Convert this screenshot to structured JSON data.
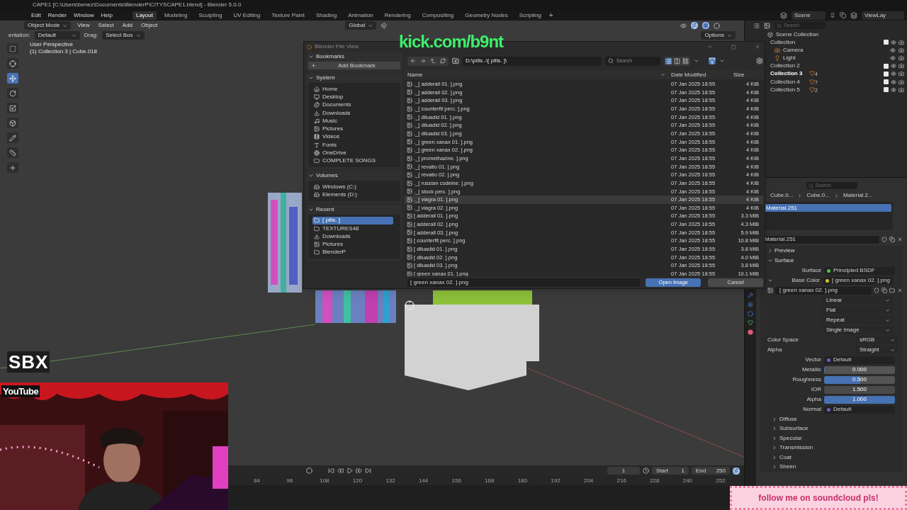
{
  "title_bar": {
    "title": "CAPE1 [C:\\Users\\benez\\Documents\\BlenderP\\CITYSCAPE1.blend] - Blender 5.0.0"
  },
  "menu": [
    "Edit",
    "Render",
    "Window",
    "Help"
  ],
  "workspaces": [
    {
      "label": "Layout",
      "selected": true
    },
    {
      "label": "Modeling",
      "selected": false
    },
    {
      "label": "Sculpting",
      "selected": false
    },
    {
      "label": "UV Editing",
      "selected": false
    },
    {
      "label": "Texture Paint",
      "selected": false
    },
    {
      "label": "Shading",
      "selected": false
    },
    {
      "label": "Animation",
      "selected": false
    },
    {
      "label": "Rendering",
      "selected": false
    },
    {
      "label": "Compositing",
      "selected": false
    },
    {
      "label": "Geometry Nodes",
      "selected": false
    },
    {
      "label": "Scripting",
      "selected": false
    }
  ],
  "add_workspace": "+",
  "scene": {
    "name": "Scene",
    "view_layer": "ViewLay"
  },
  "viewport_header": {
    "mode": "Object Mode",
    "menus": [
      "View",
      "Select",
      "Add",
      "Object"
    ],
    "orientation": "Global",
    "options": "Options"
  },
  "tool_settings": {
    "orientation_label": "entation:",
    "orientation": "Default",
    "drag_label": "Drag:",
    "drag": "Select Box"
  },
  "viewport_info": [
    "User Perspective",
    "(1) Collection 3 | Cube.018"
  ],
  "tools": [
    {
      "kind": "select",
      "selected": false
    },
    {
      "kind": "cursor",
      "selected": false
    },
    {
      "kind": "move",
      "selected": true
    },
    {
      "kind": "rotate",
      "selected": false
    },
    {
      "kind": "scale",
      "selected": false
    },
    {
      "kind": "transform",
      "selected": false
    },
    {
      "kind": "annotate",
      "selected": false
    },
    {
      "kind": "measure",
      "selected": false
    },
    {
      "kind": "add_cube",
      "selected": false
    }
  ],
  "outliner": {
    "search_placeholder": "Search",
    "root": "Scene Collection",
    "collections": [
      {
        "name": "Collection",
        "checked": true,
        "selected": false,
        "children": [
          {
            "name": "Camera",
            "kind": "camera"
          },
          {
            "name": "Light",
            "kind": "light"
          }
        ]
      },
      {
        "name": "Collection 2",
        "checked": true,
        "selected": false
      },
      {
        "name": "Collection 3",
        "checked": true,
        "selected": true,
        "mesh_count": "4"
      },
      {
        "name": "Collection 4",
        "checked": true,
        "selected": false,
        "mesh_count": "7"
      },
      {
        "name": "Collection 5",
        "checked": true,
        "selected": false,
        "mesh_count": "2"
      }
    ]
  },
  "file_dialog": {
    "title": "Blender File View",
    "sections": [
      {
        "label": "Bookmarks",
        "expanded": true,
        "button": "Add Bookmark"
      },
      {
        "label": "System",
        "expanded": true,
        "items": [
          {
            "label": "Home",
            "kind": "home",
            "selected": false
          },
          {
            "label": "Desktop",
            "kind": "desktop",
            "selected": false
          },
          {
            "label": "Documents",
            "kind": "documents",
            "selected": false
          },
          {
            "label": "Downloads",
            "kind": "downloads",
            "selected": false
          },
          {
            "label": "Music",
            "kind": "music",
            "selected": false
          },
          {
            "label": "Pictures",
            "kind": "pictures",
            "selected": false
          },
          {
            "label": "Videos",
            "kind": "videos",
            "selected": false
          },
          {
            "label": "Fonts",
            "kind": "fonts",
            "selected": false
          },
          {
            "label": "OneDrive",
            "kind": "cloud",
            "selected": false
          },
          {
            "label": "COMPLETE SONGS",
            "kind": "folder",
            "selected": false
          }
        ]
      },
      {
        "label": "Volumes",
        "expanded": true,
        "items": [
          {
            "label": "Windows (C:)",
            "kind": "drive",
            "selected": false
          },
          {
            "label": "Elements (D:)",
            "kind": "drive",
            "selected": false
          }
        ]
      },
      {
        "label": "Recent",
        "expanded": true,
        "items": [
          {
            "label": "[ pills. ]",
            "kind": "folder",
            "selected": true
          },
          {
            "label": "TEXTURES48",
            "kind": "folder",
            "selected": false
          },
          {
            "label": "Downloads",
            "kind": "downloads",
            "selected": false
          },
          {
            "label": "Pictures",
            "kind": "pictures",
            "selected": false
          },
          {
            "label": "BlenderP",
            "kind": "folder",
            "selected": false
          }
        ]
      }
    ],
    "path": "D:\\pills.-\\[ pills. ]\\",
    "search_placeholder": "Search",
    "columns": [
      "Name",
      "Date Modified",
      "Size"
    ],
    "files": [
      {
        "name": "._[ adderall 01. ].png",
        "date": "07 Jan 2025 18:55",
        "size": "4 KiB",
        "selected": false
      },
      {
        "name": "._[ adderall 02. ].png",
        "date": "07 Jan 2025 18:55",
        "size": "4 KiB",
        "selected": false
      },
      {
        "name": "._[ adderall 03. ].png",
        "date": "07 Jan 2025 18:55",
        "size": "4 KiB",
        "selected": false
      },
      {
        "name": "._[ counterfit perc. ].png",
        "date": "07 Jan 2025 18:55",
        "size": "4 KiB",
        "selected": false
      },
      {
        "name": "._[ diluadid 01. ].png",
        "date": "07 Jan 2025 18:55",
        "size": "4 KiB",
        "selected": false
      },
      {
        "name": "._[ diluadid 02. ].png",
        "date": "07 Jan 2025 18:55",
        "size": "4 KiB",
        "selected": false
      },
      {
        "name": "._[ diluadid 03. ].png",
        "date": "07 Jan 2025 18:55",
        "size": "4 KiB",
        "selected": false
      },
      {
        "name": "._[ green xanax 01. ].png",
        "date": "07 Jan 2025 18:55",
        "size": "4 KiB",
        "selected": false
      },
      {
        "name": "._[ green xanax 02. ].png",
        "date": "07 Jan 2025 18:55",
        "size": "4 KiB",
        "selected": false
      },
      {
        "name": "._[ promethazine. ].png",
        "date": "07 Jan 2025 18:55",
        "size": "4 KiB",
        "selected": false
      },
      {
        "name": "._[ revatio 01. ].png",
        "date": "07 Jan 2025 18:55",
        "size": "4 KiB",
        "selected": false
      },
      {
        "name": "._[ revatio 02. ].png",
        "date": "07 Jan 2025 18:55",
        "size": "4 KiB",
        "selected": false
      },
      {
        "name": "._[ russian codeine. ].png",
        "date": "07 Jan 2025 18:55",
        "size": "4 KiB",
        "selected": false
      },
      {
        "name": "._[ stock perc. ].png",
        "date": "07 Jan 2025 18:55",
        "size": "4 KiB",
        "selected": false
      },
      {
        "name": "._[ viagra 01. ].png",
        "date": "07 Jan 2025 18:55",
        "size": "4 KiB",
        "selected": true
      },
      {
        "name": "._[ viagra 02. ].png",
        "date": "07 Jan 2025 18:55",
        "size": "4 KiB",
        "selected": false
      },
      {
        "name": "[ adderall 01. ].png",
        "date": "07 Jan 2025 18:55",
        "size": "3.3 MiB",
        "selected": false
      },
      {
        "name": "[ adderall 02. ].png",
        "date": "07 Jan 2025 18:55",
        "size": "4.3 MiB",
        "selected": false
      },
      {
        "name": "[ adderall 03. ].png",
        "date": "07 Jan 2025 18:55",
        "size": "5.9 MiB",
        "selected": false
      },
      {
        "name": "[ counterfit perc. ].png",
        "date": "07 Jan 2025 18:55",
        "size": "10.8 MiB",
        "selected": false
      },
      {
        "name": "[ diluadid 01. ].png",
        "date": "07 Jan 2025 18:55",
        "size": "3.8 MiB",
        "selected": false
      },
      {
        "name": "[ diluadid 02. ].png",
        "date": "07 Jan 2025 18:55",
        "size": "4.0 MiB",
        "selected": false
      },
      {
        "name": "[ diluadid 03. ].png",
        "date": "07 Jan 2025 18:55",
        "size": "3.8 MiB",
        "selected": false
      },
      {
        "name": "[ green xanax 01. ].png",
        "date": "07 Jan 2025 18:55",
        "size": "10.1 MiB",
        "selected": false
      }
    ],
    "filename": "[ green xanax 02. ].png",
    "open_button": "Open Image",
    "cancel_button": "Cancel"
  },
  "properties": {
    "search_placeholder": "Search",
    "breadcrumb": [
      "Cube.0...",
      "Cube.0...",
      "Material.2..."
    ],
    "slots": [
      {
        "name": "Material.251",
        "selected": true
      }
    ],
    "material": "Material.251",
    "panels": [
      {
        "label": "Preview",
        "expanded": false
      },
      {
        "label": "Surface",
        "expanded": true
      }
    ],
    "surface": {
      "label": "Surface",
      "value": "Principled BSDF",
      "color": "#4cc24c"
    },
    "base_color": {
      "label": "Base Color",
      "value": "[ green xanax 02. ].png",
      "color": "#c8c832",
      "expanded": true
    },
    "image": "[ green xanax 02. ].png",
    "image_options": [
      "Linear",
      "Flat",
      "Repeat",
      "Single Image"
    ],
    "color_space": {
      "label": "Color Space",
      "value": "sRGB"
    },
    "alpha_mode": {
      "label": "Alpha",
      "value": "Straight"
    },
    "inputs": [
      {
        "kind": "link",
        "label": "Vector",
        "value": "Default",
        "color": "#6b5fd0"
      },
      {
        "kind": "slider",
        "label": "Metallic",
        "value": "0.000",
        "level": 0
      },
      {
        "kind": "slider",
        "label": "Roughness",
        "value": "0.500",
        "level": 0.5
      },
      {
        "kind": "number",
        "label": "IOR",
        "value": "1.500"
      },
      {
        "kind": "slider",
        "label": "Alpha",
        "value": "1.000",
        "level": 1
      },
      {
        "kind": "link",
        "label": "Normal",
        "value": "Default",
        "color": "#6b5fd0"
      }
    ],
    "subpanels": [
      {
        "label": "Diffuse",
        "expanded": false
      },
      {
        "label": "Subsurface",
        "expanded": false
      },
      {
        "label": "Specular",
        "expanded": false
      },
      {
        "label": "Transmission",
        "expanded": false
      },
      {
        "label": "Coat",
        "expanded": false
      },
      {
        "label": "Sheen",
        "expanded": false
      }
    ]
  },
  "timeline": {
    "frame": "1",
    "start_label": "Start",
    "start": "1",
    "end_label": "End",
    "end": "250",
    "ruler": [
      "84",
      "96",
      "108",
      "120",
      "132",
      "144",
      "156",
      "168",
      "180",
      "192",
      "204",
      "216",
      "228",
      "240",
      "252"
    ]
  },
  "overlays": {
    "kick": "kick.com/b9nt",
    "logo": "SBX",
    "youtube": "YouTube",
    "banner": "follow me on soundcloud pls!"
  }
}
